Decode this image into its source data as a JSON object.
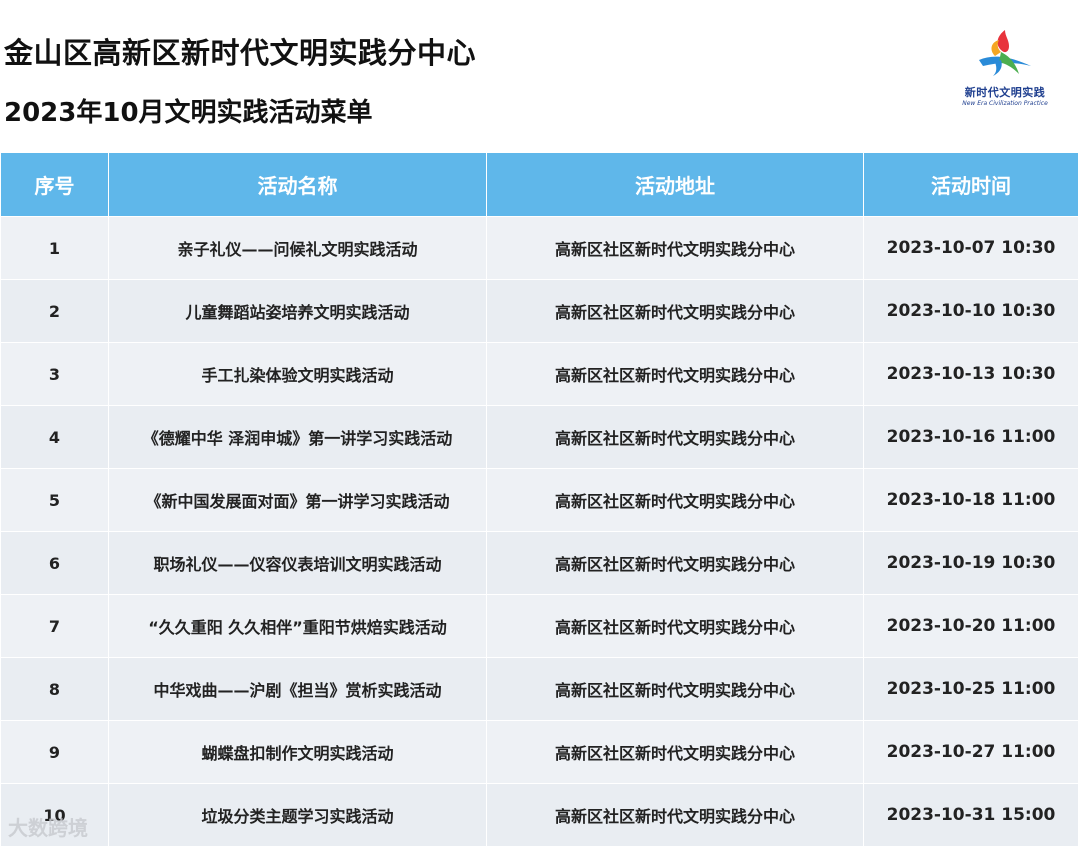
{
  "header": {
    "title": "金山区高新区新时代文明实践分中心",
    "subtitle": "2023年10月文明实践活动菜单"
  },
  "logo": {
    "cn": "新时代文明实践",
    "en": "New Era Civilization Practice",
    "colors": [
      "#e8343c",
      "#f5a623",
      "#2a8bd8",
      "#4cae4f"
    ]
  },
  "table": {
    "columns": [
      "序号",
      "活动名称",
      "活动地址",
      "活动时间"
    ],
    "rows": [
      {
        "no": "1",
        "name": "亲子礼仪——问候礼文明实践活动",
        "address": "高新区社区新时代文明实践分中心",
        "time": "2023-10-07 10:30"
      },
      {
        "no": "2",
        "name": "儿童舞蹈站姿培养文明实践活动",
        "address": "高新区社区新时代文明实践分中心",
        "time": "2023-10-10 10:30"
      },
      {
        "no": "3",
        "name": "手工扎染体验文明实践活动",
        "address": "高新区社区新时代文明实践分中心",
        "time": "2023-10-13 10:30"
      },
      {
        "no": "4",
        "name": "《德耀中华 泽润申城》第一讲学习实践活动",
        "address": "高新区社区新时代文明实践分中心",
        "time": "2023-10-16 11:00"
      },
      {
        "no": "5",
        "name": "《新中国发展面对面》第一讲学习实践活动",
        "address": "高新区社区新时代文明实践分中心",
        "time": "2023-10-18 11:00"
      },
      {
        "no": "6",
        "name": "职场礼仪——仪容仪表培训文明实践活动",
        "address": "高新区社区新时代文明实践分中心",
        "time": "2023-10-19 10:30"
      },
      {
        "no": "7",
        "name": "“久久重阳 久久相伴”重阳节烘焙实践活动",
        "address": "高新区社区新时代文明实践分中心",
        "time": "2023-10-20 11:00"
      },
      {
        "no": "8",
        "name": "中华戏曲——沪剧《担当》赏析实践活动",
        "address": "高新区社区新时代文明实践分中心",
        "time": "2023-10-25 11:00"
      },
      {
        "no": "9",
        "name": "蝴蝶盘扣制作文明实践活动",
        "address": "高新区社区新时代文明实践分中心",
        "time": "2023-10-27 11:00"
      },
      {
        "no": "10",
        "name": "垃圾分类主题学习实践活动",
        "address": "高新区社区新时代文明实践分中心",
        "time": "2023-10-31 15:00"
      }
    ]
  },
  "watermark": "大数跨境",
  "colors": {
    "header_bg": "#5fb7ea",
    "row_bg": "#eef1f5"
  }
}
